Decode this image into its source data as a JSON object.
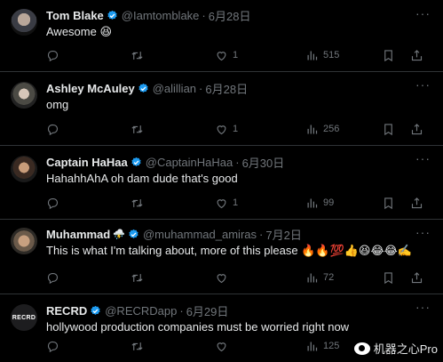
{
  "tweets": [
    {
      "name": "Tom Blake",
      "badge_emoji": "",
      "handle": "@Iamtomblake",
      "dot": "·",
      "date": "6月28日",
      "text": "Awesome 😆",
      "replies": "",
      "retweets": "",
      "likes": "1",
      "views": "515"
    },
    {
      "name": "Ashley McAuley",
      "badge_emoji": "",
      "handle": "@alillian",
      "dot": "·",
      "date": "6月28日",
      "text": "omg",
      "replies": "",
      "retweets": "",
      "likes": "1",
      "views": "256"
    },
    {
      "name": "Captain HaHaa",
      "badge_emoji": "",
      "handle": "@CaptainHaHaa",
      "dot": "·",
      "date": "6月30日",
      "text": "HahahhAhA oh dam dude that's good",
      "replies": "",
      "retweets": "",
      "likes": "1",
      "views": "99"
    },
    {
      "name": "Muhammad",
      "badge_emoji": "⛈️",
      "handle": "@muhammad_amiras",
      "dot": "·",
      "date": "7月2日",
      "text": "This is what I'm talking about, more of this please 🔥🔥💯👍😆😂😂✍️",
      "replies": "",
      "retweets": "",
      "likes": "",
      "views": "72"
    },
    {
      "name": "RECRD",
      "badge_emoji": "",
      "handle": "@RECRDapp",
      "dot": "·",
      "date": "6月29日",
      "text": "hollywood production companies must be worried right now",
      "replies": "",
      "retweets": "",
      "likes": "",
      "views": "125"
    }
  ],
  "avatar5_logo": "RECRD",
  "more_glyph": "···",
  "colors": {
    "background": "#000000",
    "text": "#e7e9ea",
    "muted": "#71767b",
    "verified": "#1d9bf0",
    "divider": "#2f3336"
  },
  "icons": [
    "reply-icon",
    "retweet-icon",
    "like-icon",
    "views-icon",
    "bookmark-icon",
    "share-icon",
    "verified-badge-icon",
    "more-icon"
  ],
  "watermark": "机器之心Pro"
}
